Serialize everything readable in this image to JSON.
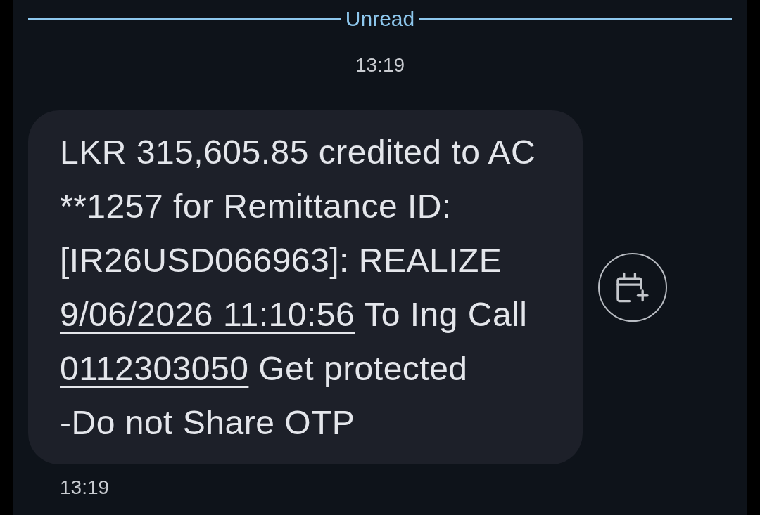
{
  "divider": {
    "label": "Unread"
  },
  "timestamp": "13:19",
  "message": {
    "segments": [
      {
        "kind": "text",
        "text": "LKR 315,605.85 credited to AC **1257 for Remittance ID: [IR26USD066963]: REALIZE "
      },
      {
        "kind": "link",
        "text": "9/06/2026 11:10:56"
      },
      {
        "kind": "text",
        "text": " To Ing Call "
      },
      {
        "kind": "link",
        "text": "0112303050"
      },
      {
        "kind": "text",
        "text": " Get protected\n-Do not Share OTP"
      }
    ],
    "time": "13:19"
  }
}
